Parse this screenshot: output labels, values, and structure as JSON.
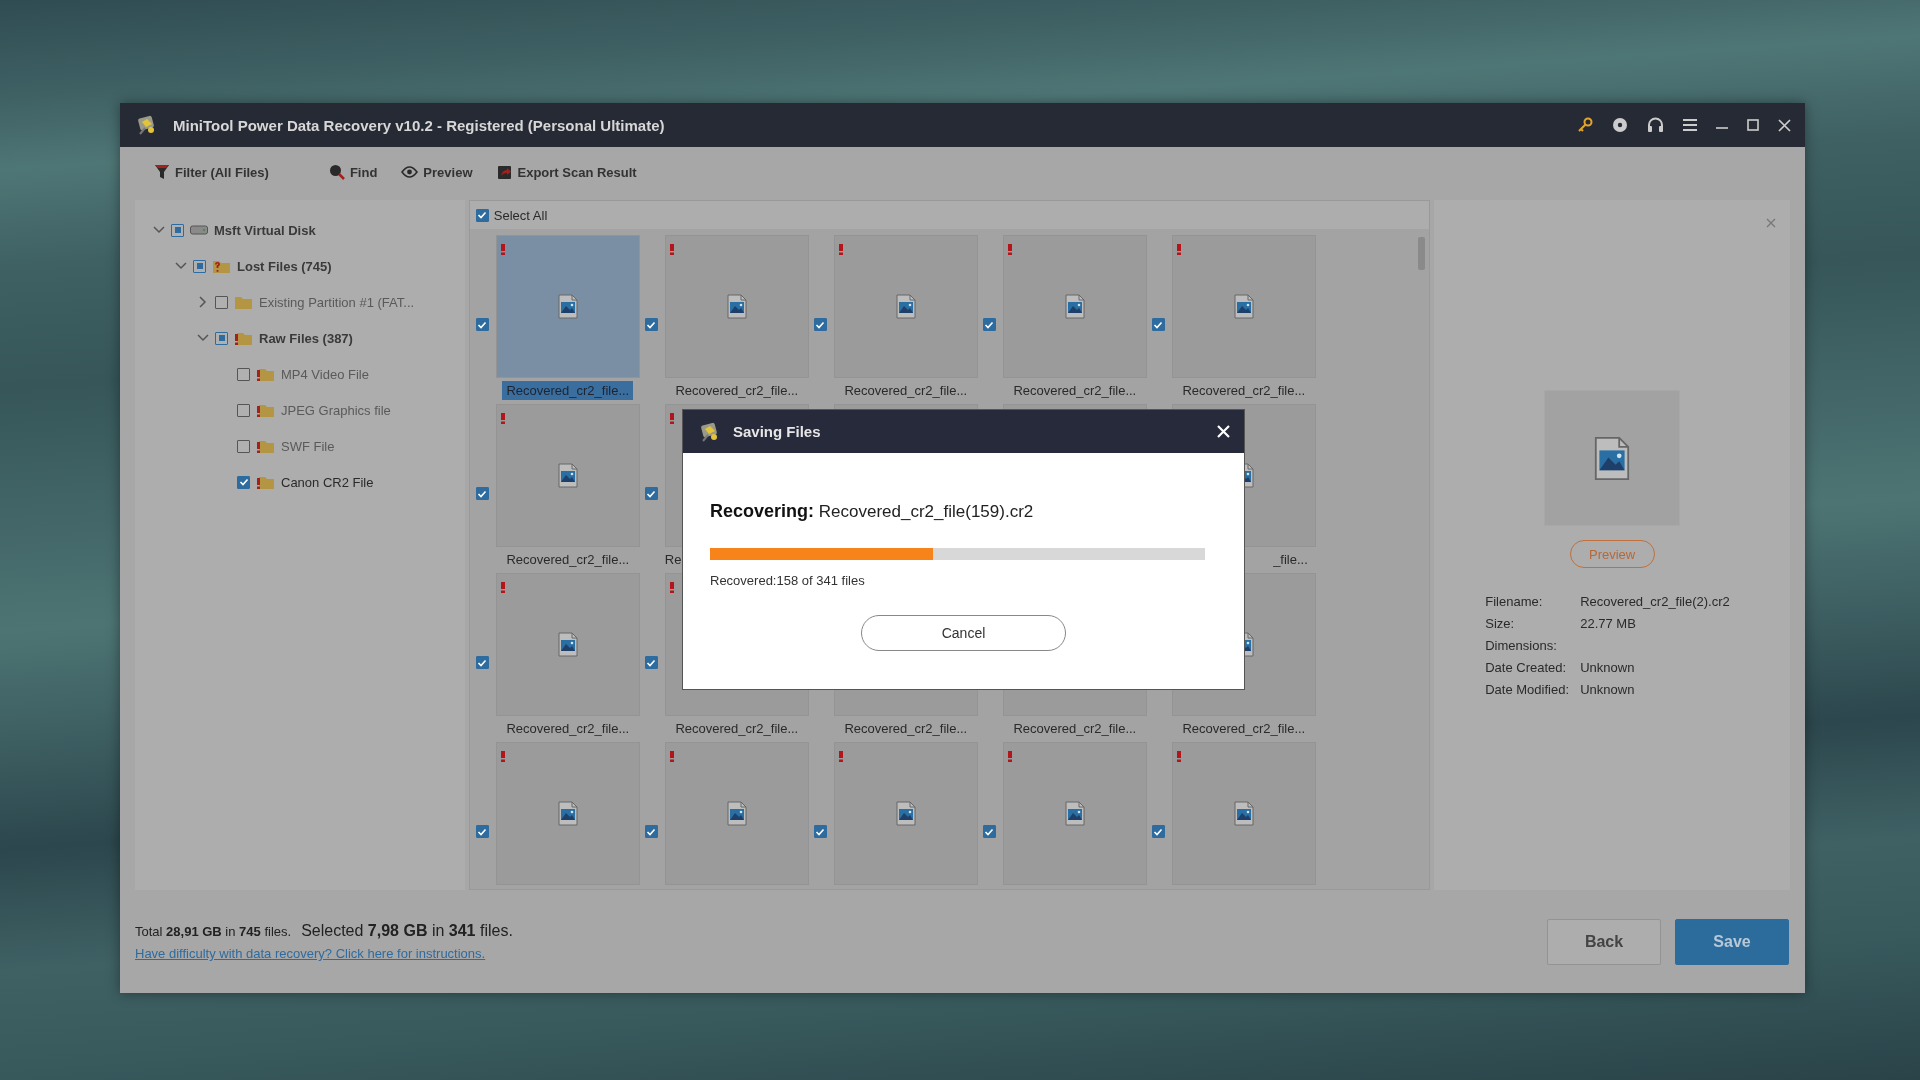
{
  "window": {
    "title": "MiniTool Power Data Recovery v10.2 - Registered (Personal Ultimate)"
  },
  "toolbar": [
    {
      "kind": "filter",
      "label": "Filter (All Files)"
    },
    {
      "kind": "find",
      "label": "Find"
    },
    {
      "kind": "preview",
      "label": "Preview"
    },
    {
      "kind": "export",
      "label": "Export Scan Result"
    }
  ],
  "tree": [
    {
      "label": "Msft Virtual Disk",
      "kind": "disk",
      "checked": true,
      "partial": true,
      "expanded": true,
      "children": [
        {
          "label": "Lost Files (745)",
          "kind": "lost",
          "checked": true,
          "partial": true,
          "expanded": true,
          "children": [
            {
              "label": "Existing Partition #1 (FAT...",
              "kind": "partition",
              "checked": false,
              "expanded": false
            },
            {
              "label": "Raw Files (387)",
              "kind": "raw",
              "checked": true,
              "partial": true,
              "expanded": true,
              "children": [
                {
                  "label": "MP4 Video File",
                  "kind": "raw",
                  "checked": false
                },
                {
                  "label": "JPEG Graphics file",
                  "kind": "raw",
                  "checked": false
                },
                {
                  "label": "SWF File",
                  "kind": "raw",
                  "checked": false
                },
                {
                  "label": "Canon CR2 File",
                  "kind": "raw",
                  "checked": true
                }
              ]
            }
          ]
        }
      ]
    }
  ],
  "grid": {
    "select_all": {
      "label": "Select All",
      "checked": true
    },
    "tiles": [
      {
        "label": "Recovered_cr2_file...",
        "checked": true,
        "selected": true
      },
      {
        "label": "Recovered_cr2_file...",
        "checked": true,
        "selected": false
      },
      {
        "label": "Recovered_cr2_file...",
        "checked": true,
        "selected": false
      },
      {
        "label": "Recovered_cr2_file...",
        "checked": true,
        "selected": false
      },
      {
        "label": "Recovered_cr2_file...",
        "checked": true,
        "selected": false
      },
      {
        "label": "Recovered_cr2_file...",
        "checked": true,
        "selected": false
      },
      {
        "kind": "clipped-end",
        "label": "Re",
        "checked": true,
        "selected": false
      },
      {
        "kind": "covered",
        "selected": false
      },
      {
        "kind": "covered",
        "selected": false
      },
      {
        "kind": "clipped-start",
        "label": "_file...",
        "selected": false
      },
      {
        "label": "Recovered_cr2_file...",
        "checked": true,
        "selected": false
      },
      {
        "kind": "covered",
        "label": "Recovered_cr2_file...",
        "checked": true,
        "selected": false
      },
      {
        "label": "Recovered_cr2_file..."
      },
      {
        "label": "Recovered_cr2_file..."
      },
      {
        "label": "Recovered_cr2_file...",
        "selected": false
      },
      {
        "checked": true,
        "selected": false
      },
      {
        "checked": true,
        "selected": false
      },
      {
        "checked": true,
        "selected": false
      },
      {
        "checked": true,
        "selected": false
      },
      {
        "checked": true,
        "selected": false
      }
    ]
  },
  "details": {
    "preview_button": "Preview",
    "fields": [
      {
        "label": "Filename:",
        "value": "Recovered_cr2_file(2).cr2"
      },
      {
        "label": "Size:",
        "value": "22.77 MB"
      },
      {
        "label": "Dimensions:"
      },
      {
        "label": "Date Created:",
        "value": "Unknown"
      },
      {
        "label": "Date Modified:",
        "value": "Unknown"
      }
    ]
  },
  "status": {
    "total": "Total **28,91 GB** in **745** files.",
    "selected": "Selected **7,98 GB** in **341** files.",
    "help_link": "Have difficulty with data recovery? Click here for instructions."
  },
  "buttons": [
    "Back",
    "Save"
  ],
  "dialog": {
    "title": "Saving Files",
    "recovering": "**Recovering:** Recovered_cr2_file(159).cr2",
    "level": 0.45,
    "progress_text": "Recovered:158 of 341 files",
    "cancel": "Cancel"
  }
}
